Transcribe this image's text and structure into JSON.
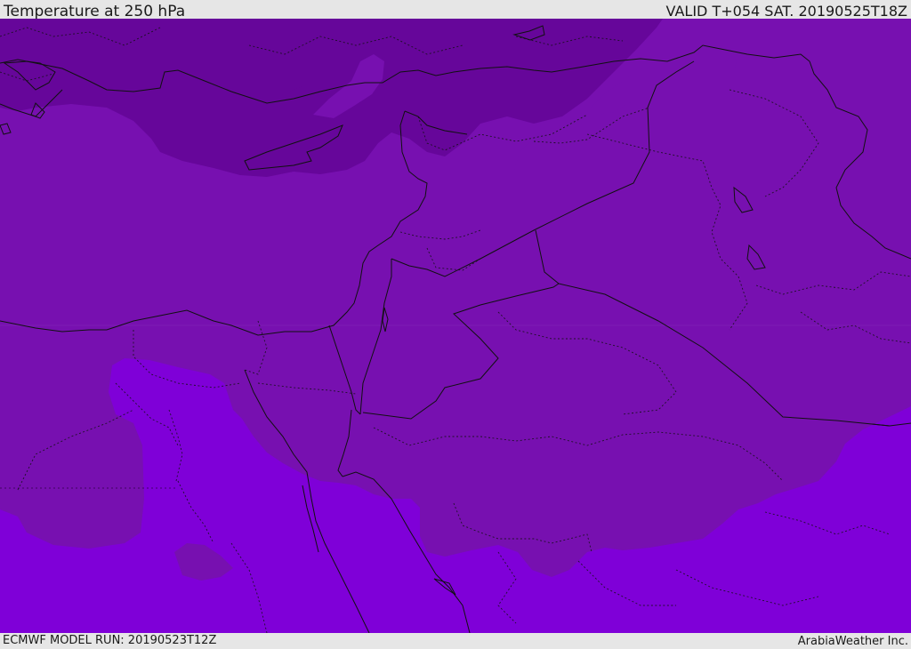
{
  "header": {
    "title": "Temperature at 250 hPa",
    "valid": "VALID T+054 SAT. 20190525T18Z"
  },
  "footer": {
    "model_run": "ECMWF MODEL RUN: 20190523T12Z",
    "credit": "ArabiaWeather Inc."
  },
  "colors": {
    "dark_band": "#66069a",
    "mid_band": "#7710b0",
    "light_band": "#7f00d8",
    "border_line": "#111111",
    "background": "#e6e6e6"
  }
}
